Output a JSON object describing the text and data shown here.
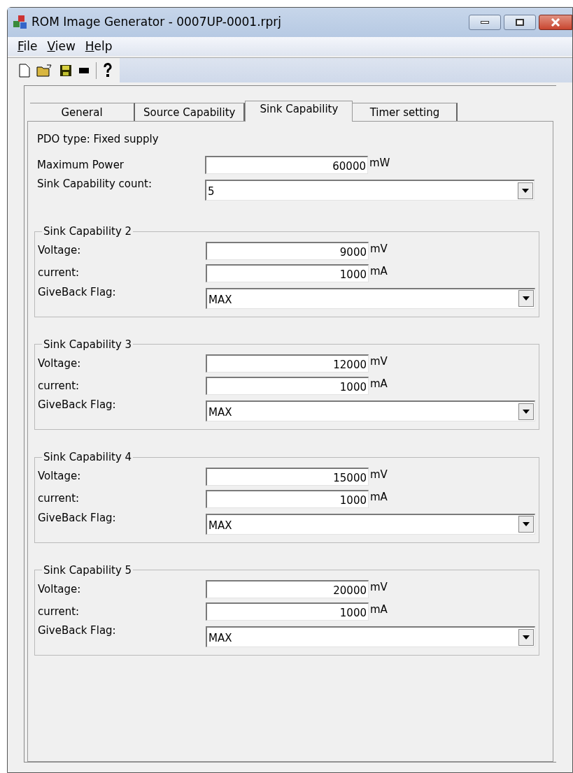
{
  "window": {
    "title": "ROM Image Generator - 0007UP-0001.rprj"
  },
  "menu": [
    {
      "label": "File"
    },
    {
      "label": "View"
    },
    {
      "label": "Help"
    }
  ],
  "tabs": [
    {
      "label": "General",
      "selected": false
    },
    {
      "label": "Source Capability",
      "selected": false
    },
    {
      "label": "Sink Capability",
      "selected": true
    },
    {
      "label": "Timer setting",
      "selected": false
    }
  ],
  "pdo_type": "PDO type: Fixed supply",
  "maximum_power": {
    "label": "Maximum Power",
    "value": "60000",
    "unit": "mW"
  },
  "count": {
    "label": "Sink Capability count:",
    "value": "5"
  },
  "groups": [
    {
      "title": "Sink Capability 2",
      "voltage": {
        "label": "Voltage:",
        "value": "9000",
        "unit": "mV"
      },
      "current": {
        "label": "current:",
        "value": "1000",
        "unit": "mA"
      },
      "giveback": {
        "label": "GiveBack Flag:",
        "value": "MAX"
      }
    },
    {
      "title": "Sink Capability 3",
      "voltage": {
        "label": "Voltage:",
        "value": "12000",
        "unit": "mV"
      },
      "current": {
        "label": "current:",
        "value": "1000",
        "unit": "mA"
      },
      "giveback": {
        "label": "GiveBack Flag:",
        "value": "MAX"
      }
    },
    {
      "title": "Sink Capability 4",
      "voltage": {
        "label": "Voltage:",
        "value": "15000",
        "unit": "mV"
      },
      "current": {
        "label": "current:",
        "value": "1000",
        "unit": "mA"
      },
      "giveback": {
        "label": "GiveBack Flag:",
        "value": "MAX"
      }
    },
    {
      "title": "Sink Capability 5",
      "voltage": {
        "label": "Voltage:",
        "value": "20000",
        "unit": "mV"
      },
      "current": {
        "label": "current:",
        "value": "1000",
        "unit": "mA"
      },
      "giveback": {
        "label": "GiveBack Flag:",
        "value": "MAX"
      }
    }
  ]
}
